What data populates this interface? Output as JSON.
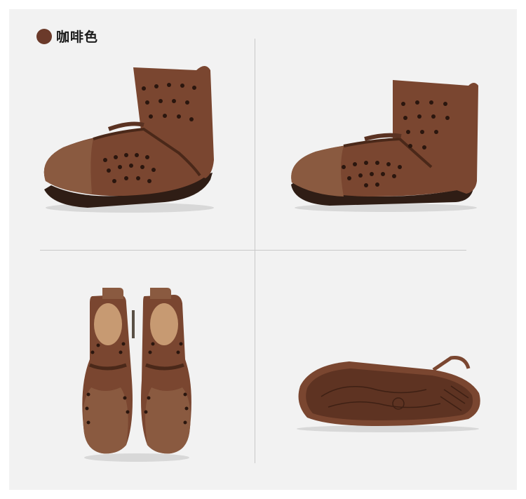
{
  "color_option": {
    "name": "咖啡色",
    "swatch_color": "#6b3a2a"
  },
  "colors": {
    "leather": "#7a4630",
    "leather_dark": "#4a2819",
    "suede": "#8a5a40",
    "sole": "#2f1d15",
    "background": "#f2f2f2"
  }
}
